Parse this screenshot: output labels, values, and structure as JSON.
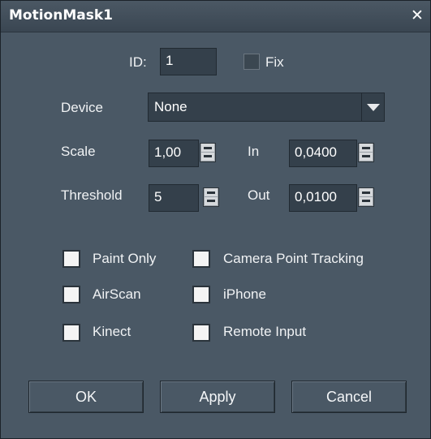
{
  "window": {
    "title": "MotionMask1",
    "close_glyph": "✕"
  },
  "id_field": {
    "label": "ID:",
    "value": "1"
  },
  "fix_checkbox": {
    "label": "Fix",
    "checked": false
  },
  "device": {
    "label": "Device",
    "value": "None"
  },
  "scale": {
    "label": "Scale",
    "value": "1,00"
  },
  "in": {
    "label": "In",
    "value": "0,0400"
  },
  "threshold": {
    "label": "Threshold",
    "value": "5"
  },
  "out": {
    "label": "Out",
    "value": "0,0100"
  },
  "options": [
    {
      "label": "Paint Only",
      "checked": false
    },
    {
      "label": "Camera Point Tracking",
      "checked": false
    },
    {
      "label": "AirScan",
      "checked": false
    },
    {
      "label": "iPhone",
      "checked": false
    },
    {
      "label": "Kinect",
      "checked": false
    },
    {
      "label": "Remote Input",
      "checked": false
    }
  ],
  "buttons": {
    "ok": "OK",
    "apply": "Apply",
    "cancel": "Cancel"
  },
  "colors": {
    "background": "#4a5865",
    "field": "#34404b",
    "text": "#f0f2f4"
  }
}
